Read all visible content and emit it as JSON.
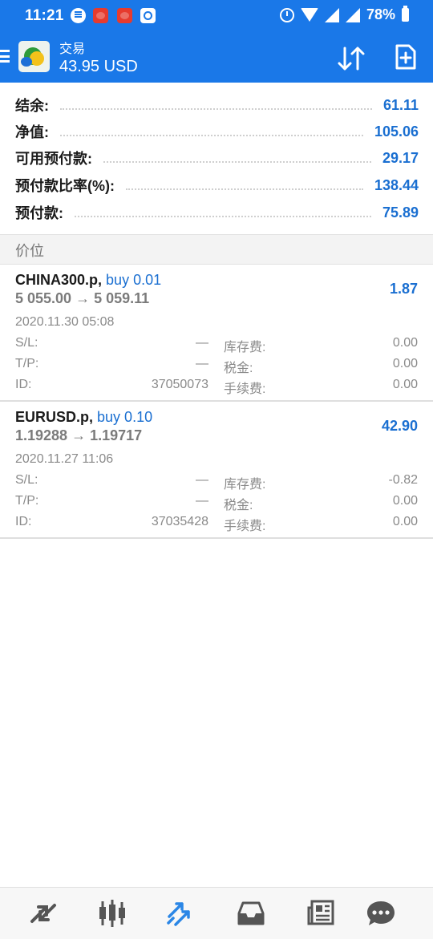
{
  "status_bar": {
    "time": "11:21",
    "battery": "78%"
  },
  "header": {
    "title": "交易",
    "balance": "43.95 USD"
  },
  "summary": [
    {
      "label": "结余:",
      "value": "61.11"
    },
    {
      "label": "净值:",
      "value": "105.06"
    },
    {
      "label": "可用预付款:",
      "value": "29.17"
    },
    {
      "label": "预付款比率(%):",
      "value": "138.44"
    },
    {
      "label": "预付款:",
      "value": "75.89"
    }
  ],
  "section_title": "价位",
  "positions": [
    {
      "symbol": "CHINA300.p,",
      "direction": "buy 0.01",
      "prices": "5 055.00 → 5 059.11",
      "profit": "1.87",
      "date": "2020.11.30 05:08",
      "sl_label": "S/L:",
      "sl_value": "—",
      "tp_label": "T/P:",
      "tp_value": "—",
      "id_label": "ID:",
      "id_value": "37050073",
      "swap_label": "库存费:",
      "swap_value": "0.00",
      "tax_label": "税金:",
      "tax_value": "0.00",
      "fee_label": "手续费:",
      "fee_value": "0.00"
    },
    {
      "symbol": "EURUSD.p,",
      "direction": "buy 0.10",
      "prices": "1.19288 → 1.19717",
      "profit": "42.90",
      "date": "2020.11.27 11:06",
      "sl_label": "S/L:",
      "sl_value": "—",
      "tp_label": "T/P:",
      "tp_value": "—",
      "id_label": "ID:",
      "id_value": "37035428",
      "swap_label": "库存费:",
      "swap_value": "-0.82",
      "tax_label": "税金:",
      "tax_value": "0.00",
      "fee_label": "手续费:",
      "fee_value": "0.00"
    }
  ],
  "bottom_nav": [
    {
      "icon": "quotes-icon"
    },
    {
      "icon": "chart-icon"
    },
    {
      "icon": "trade-icon",
      "active": true
    },
    {
      "icon": "history-icon"
    },
    {
      "icon": "news-icon"
    },
    {
      "icon": "chat-icon"
    }
  ],
  "colors": {
    "header_blue": "#1a78e8",
    "value_blue": "#1a6fd1",
    "active_nav_blue": "#2a86e6"
  }
}
